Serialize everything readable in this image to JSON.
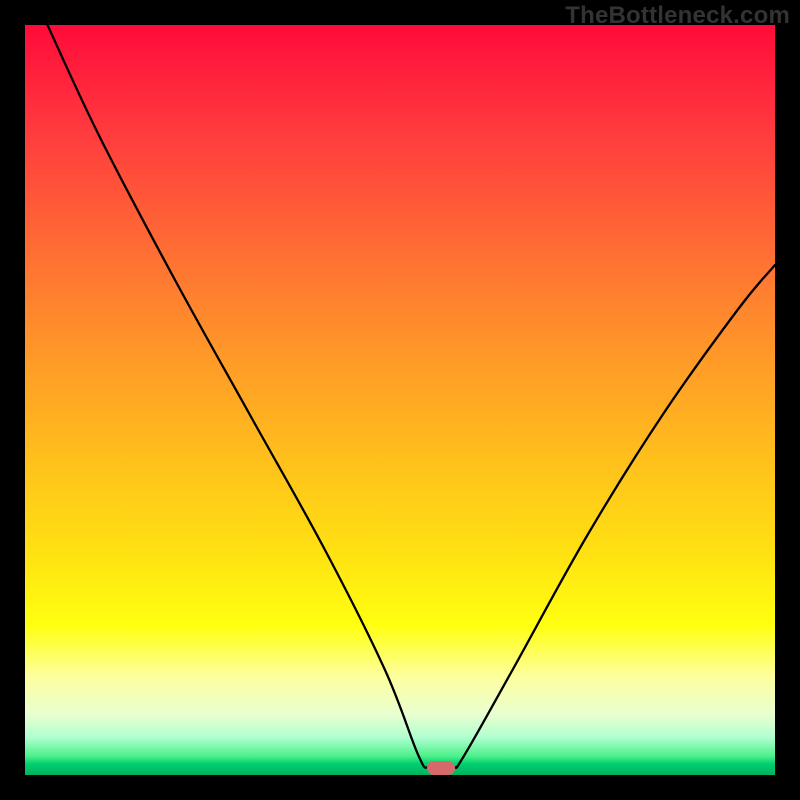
{
  "watermark": "TheBottleneck.com",
  "marker": {
    "x_pct": 55.5,
    "y_pct": 99.0
  },
  "chart_data": {
    "type": "line",
    "title": "",
    "xlabel": "",
    "ylabel": "",
    "xlim": [
      0,
      100
    ],
    "ylim": [
      0,
      100
    ],
    "background_gradient": [
      "#ff0b3a",
      "#ffc01c",
      "#ffff10",
      "#00d070"
    ],
    "curve_points": [
      {
        "x": 3.0,
        "y": 100.0
      },
      {
        "x": 10.0,
        "y": 85.0
      },
      {
        "x": 20.0,
        "y": 66.0
      },
      {
        "x": 30.0,
        "y": 48.0
      },
      {
        "x": 40.0,
        "y": 30.0
      },
      {
        "x": 48.0,
        "y": 14.0
      },
      {
        "x": 52.5,
        "y": 2.5
      },
      {
        "x": 54.0,
        "y": 1.0
      },
      {
        "x": 57.0,
        "y": 1.0
      },
      {
        "x": 58.5,
        "y": 2.5
      },
      {
        "x": 65.0,
        "y": 14.0
      },
      {
        "x": 75.0,
        "y": 32.0
      },
      {
        "x": 85.0,
        "y": 48.0
      },
      {
        "x": 95.0,
        "y": 62.0
      },
      {
        "x": 100.0,
        "y": 68.0
      }
    ],
    "marker": {
      "x": 55.5,
      "y": 1.0,
      "color": "#d66a6a"
    }
  }
}
